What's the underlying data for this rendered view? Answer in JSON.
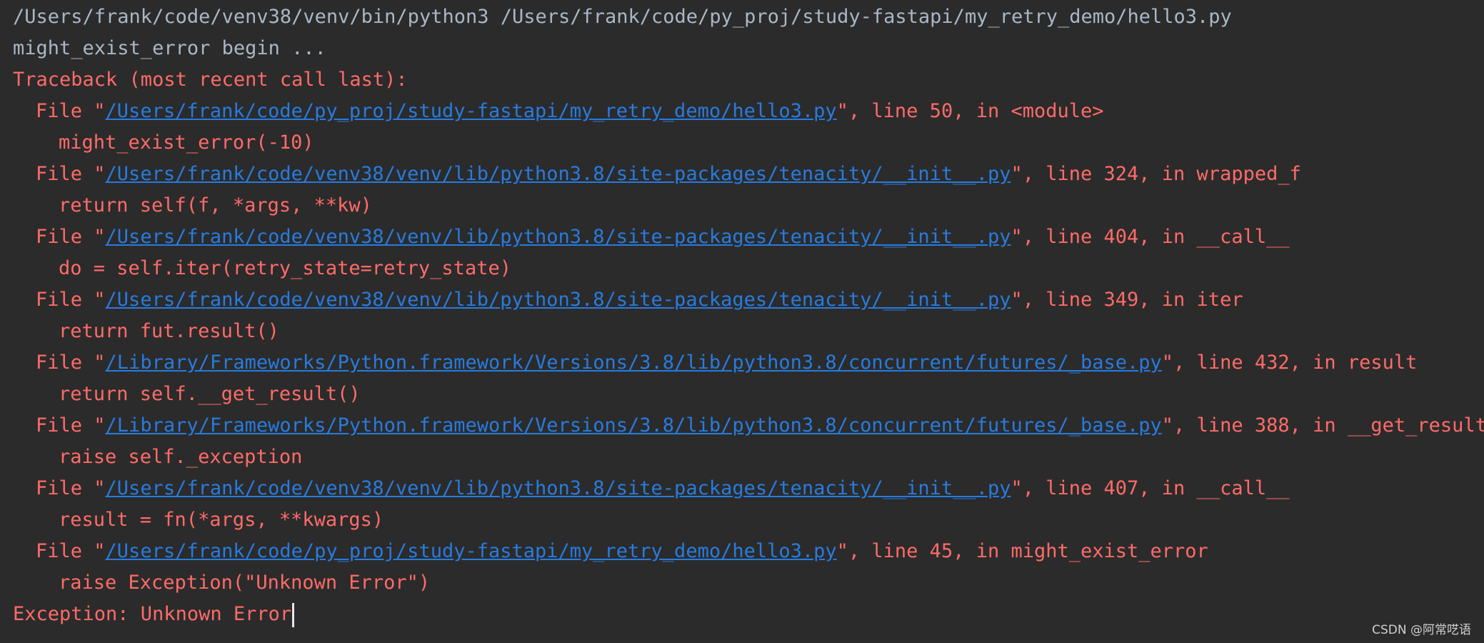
{
  "console": {
    "command_line": "/Users/frank/code/venv38/venv/bin/python3 /Users/frank/code/py_proj/study-fastapi/my_retry_demo/hello3.py",
    "begin_message": "might_exist_error begin ...",
    "traceback_header": "Traceback (most recent call last):",
    "frames": [
      {
        "prefix": "File \"",
        "path": "/Users/frank/code/py_proj/study-fastapi/my_retry_demo/hello3.py",
        "suffix": "\", line 50, in <module>",
        "code": "might_exist_error(-10)"
      },
      {
        "prefix": "File \"",
        "path": "/Users/frank/code/venv38/venv/lib/python3.8/site-packages/tenacity/__init__.py",
        "suffix": "\", line 324, in wrapped_f",
        "code": "return self(f, *args, **kw)"
      },
      {
        "prefix": "File \"",
        "path": "/Users/frank/code/venv38/venv/lib/python3.8/site-packages/tenacity/__init__.py",
        "suffix": "\", line 404, in __call__",
        "code": "do = self.iter(retry_state=retry_state)"
      },
      {
        "prefix": "File \"",
        "path": "/Users/frank/code/venv38/venv/lib/python3.8/site-packages/tenacity/__init__.py",
        "suffix": "\", line 349, in iter",
        "code": "return fut.result()"
      },
      {
        "prefix": "File \"",
        "path": "/Library/Frameworks/Python.framework/Versions/3.8/lib/python3.8/concurrent/futures/_base.py",
        "suffix": "\", line 432, in result",
        "code": "return self.__get_result()"
      },
      {
        "prefix": "File \"",
        "path": "/Library/Frameworks/Python.framework/Versions/3.8/lib/python3.8/concurrent/futures/_base.py",
        "suffix": "\", line 388, in __get_result",
        "code": "raise self._exception"
      },
      {
        "prefix": "File \"",
        "path": "/Users/frank/code/venv38/venv/lib/python3.8/site-packages/tenacity/__init__.py",
        "suffix": "\", line 407, in __call__",
        "code": "result = fn(*args, **kwargs)"
      },
      {
        "prefix": "File \"",
        "path": "/Users/frank/code/py_proj/study-fastapi/my_retry_demo/hello3.py",
        "suffix": "\", line 45, in might_exist_error",
        "code": "raise Exception(\"Unknown Error\")"
      }
    ],
    "exception_line": "Exception: Unknown Error"
  },
  "watermark": "CSDN @阿常呓语",
  "colors": {
    "background": "#2b2b2b",
    "plain_text": "#a9b7c6",
    "error_text": "#ff6b68",
    "link": "#287bde"
  }
}
